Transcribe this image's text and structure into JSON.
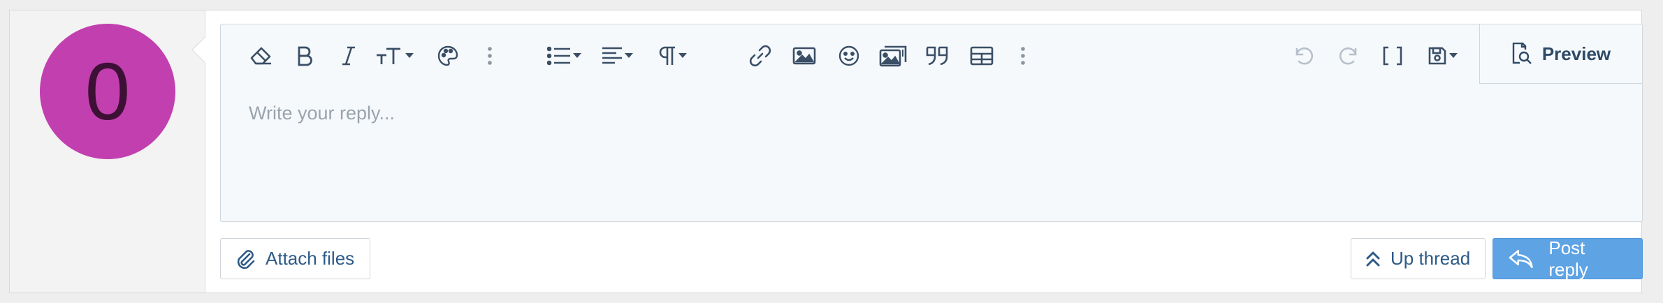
{
  "avatar": {
    "letter": "0",
    "color": "#c23faf"
  },
  "editor": {
    "placeholder": "Write your reply...",
    "preview_label": "Preview"
  },
  "toolbar": {
    "left_icons": [
      "eraser-icon",
      "bold-icon",
      "italic-icon",
      "text-size-icon",
      "palette-icon",
      "more-vertical-icon",
      "list-icon",
      "align-icon",
      "paragraph-icon",
      "link-icon",
      "image-icon",
      "smiley-icon",
      "media-gallery-icon",
      "quote-icon",
      "table-icon",
      "more-vertical-icon"
    ],
    "right_icons": [
      "undo-icon",
      "redo-icon",
      "bbcode-brackets-icon",
      "drafts-save-icon"
    ]
  },
  "actions": {
    "attach_label": "Attach files",
    "up_thread_label": "Up thread",
    "post_reply_label": "Post reply"
  },
  "colors": {
    "accent": "#5ea3e4",
    "icon": "#3a4f66",
    "editor_bg": "#f6f9fc"
  }
}
